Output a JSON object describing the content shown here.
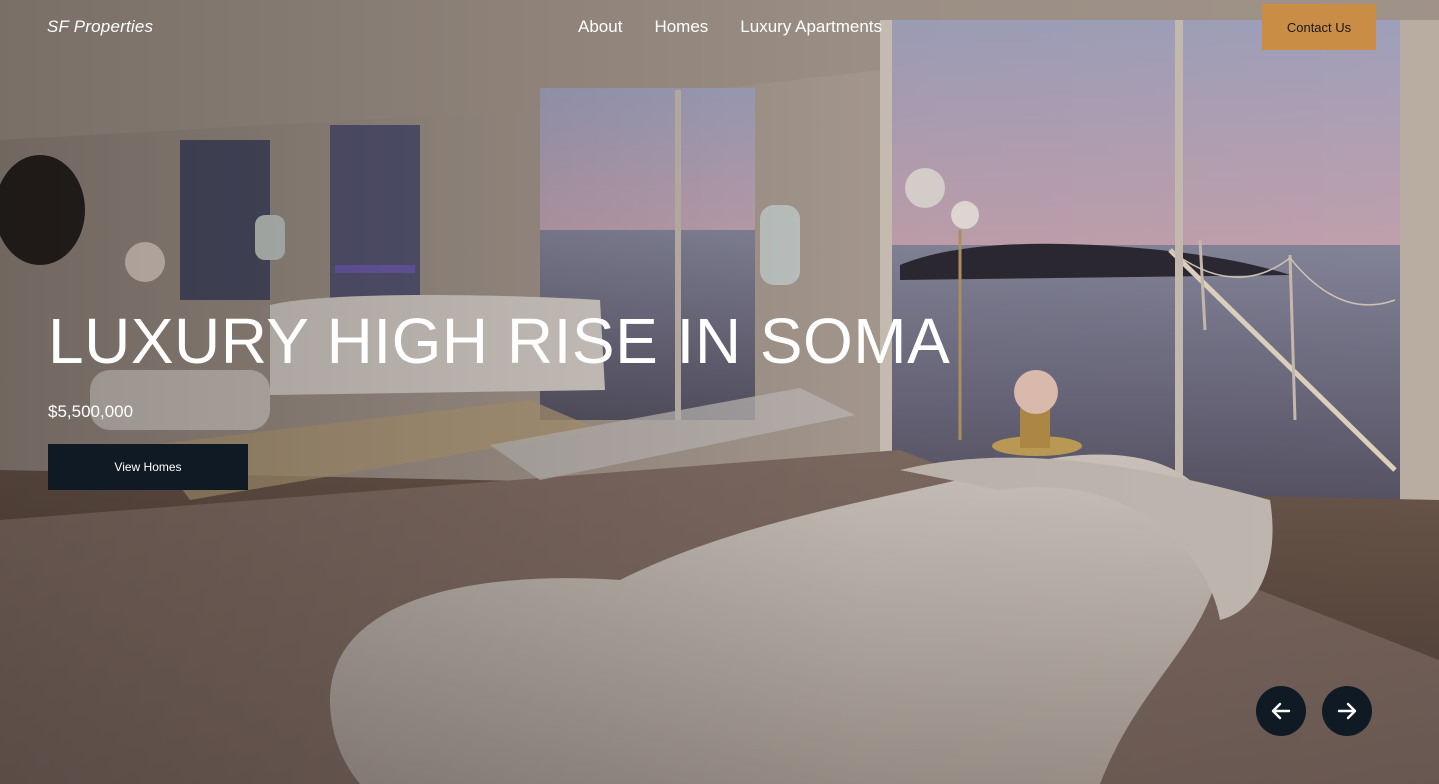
{
  "header": {
    "brand": "SF Properties",
    "nav": [
      "About",
      "Homes",
      "Luxury Apartments"
    ],
    "contact_label": "Contact Us"
  },
  "hero": {
    "title": "LUXURY HIGH RISE IN SOMA",
    "price": "$5,500,000",
    "cta_label": "View Homes",
    "background_image": "luxury-living-room-bay-bridge-view"
  },
  "slider": {
    "prev_icon": "arrow-left-icon",
    "next_icon": "arrow-right-icon"
  },
  "colors": {
    "accent": "#c98d45",
    "dark": "#0f1a24",
    "text": "#ffffff"
  }
}
